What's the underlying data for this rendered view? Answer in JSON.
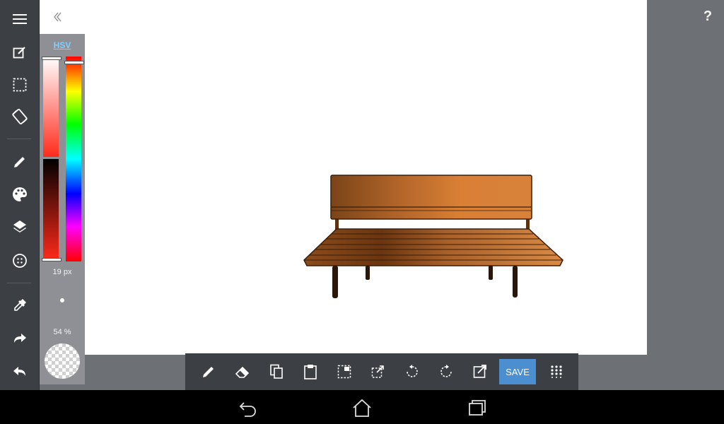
{
  "color_panel": {
    "mode_label": "HSV",
    "brush_size": "19 px",
    "opacity": "54 %"
  },
  "bottom_toolbar": {
    "save_label": "SAVE"
  },
  "help": {
    "label": "?"
  },
  "colors": {
    "toolbar_bg": "#3c3f44",
    "panel_bg": "#8e9095",
    "accent": "#4b8fd1",
    "hsv_link": "#7fd0ff"
  },
  "icons": {
    "left_toolbar": [
      "menu-icon",
      "edit-canvas-icon",
      "selection-icon",
      "rotate-canvas-icon",
      "pen-icon",
      "palette-icon",
      "layers-icon",
      "brush-settings-icon",
      "eyedropper-icon",
      "redo-icon",
      "undo-icon"
    ],
    "bottom_toolbar": [
      "pen-icon",
      "eraser-icon",
      "copy-icon",
      "paste-icon",
      "select-move-icon",
      "transform-icon",
      "rotate-left-icon",
      "rotate-right-icon",
      "export-icon",
      "grid-menu-icon"
    ],
    "nav": [
      "back-icon",
      "home-icon",
      "recents-icon"
    ]
  }
}
